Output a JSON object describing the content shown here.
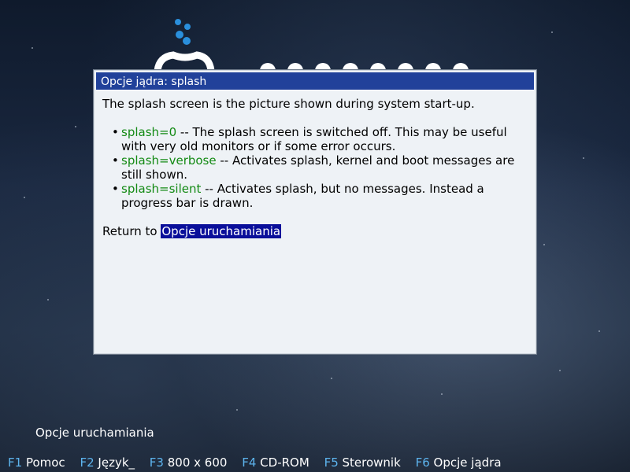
{
  "dialog": {
    "title": "Opcje jądra: splash",
    "intro": "The splash screen is the picture shown during system start-up.",
    "options": [
      {
        "key": "splash=0",
        "desc": " -- The splash screen is switched off. This may be useful with very old monitors or if some error occurs."
      },
      {
        "key": "splash=verbose",
        "desc": " -- Activates splash, kernel and boot messages are still shown."
      },
      {
        "key": "splash=silent",
        "desc": " -- Activates splash, but no messages. Instead a progress bar is drawn."
      }
    ],
    "return_prefix": "Return to ",
    "return_link": "Opcje uruchamiania"
  },
  "boot_options_label": "Opcje uruchamiania",
  "fkeys": [
    {
      "key": "F1",
      "label": "Pomoc"
    },
    {
      "key": "F2",
      "label": "Język_"
    },
    {
      "key": "F3",
      "label": "800 x 600"
    },
    {
      "key": "F4",
      "label": "CD-ROM"
    },
    {
      "key": "F5",
      "label": "Sterownik"
    },
    {
      "key": "F6",
      "label": "Opcje jądra"
    }
  ],
  "colors": {
    "title_bar": "#21419a",
    "keyword": "#138a14",
    "link_bg": "#0a0f9a",
    "fkey": "#5db4ee"
  }
}
